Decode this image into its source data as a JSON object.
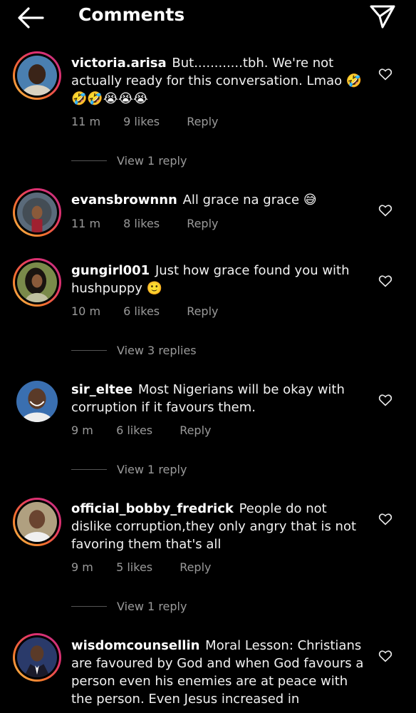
{
  "header": {
    "title": "Comments"
  },
  "comments": [
    {
      "username": "victoria.arisa",
      "text": "But............tbh. We're not actually ready for this conversation. Lmao 🤣🤣🤣😭😭😭",
      "time": "11 m",
      "likes": "9 likes",
      "reply_label": "Reply",
      "view_replies": "View 1 reply",
      "avatar_color": "#4a7fb0"
    },
    {
      "username": "evansbrownnn",
      "text": "All grace na grace 😅",
      "time": "11 m",
      "likes": "8 likes",
      "reply_label": "Reply",
      "avatar_color": "#5a6a7a"
    },
    {
      "username": "gungirl001",
      "text": "Just how grace found you with hushpuppy 🙂",
      "time": "10 m",
      "likes": "6 likes",
      "reply_label": "Reply",
      "view_replies": "View 3 replies",
      "avatar_color": "#7a8a4a"
    },
    {
      "username": "sir_eltee",
      "text": "Most Nigerians will be okay with corruption if it favours them.",
      "time": "9 m",
      "likes": "6 likes",
      "reply_label": "Reply",
      "view_replies": "View 1 reply",
      "avatar_color": "#3a6fb0"
    },
    {
      "username": "official_bobby_fredrick",
      "text": "People do not dislike corruption,they only angry that is not favoring them that's all",
      "time": "9 m",
      "likes": "5 likes",
      "reply_label": "Reply",
      "view_replies": "View 1 reply",
      "avatar_color": "#b0a080"
    },
    {
      "username": "wisdomcounsellin",
      "text": "Moral Lesson: Christians are favoured by God and when God favours a person even his enemies are at peace with the person. Even Jesus increased in",
      "avatar_color": "#2a3a6a"
    }
  ],
  "icons": {
    "back": "arrow-left-icon",
    "send": "paper-plane-icon",
    "like": "heart-outline-icon"
  },
  "colors": {
    "background": "#000000",
    "text": "#f1f1f1",
    "muted": "#9a9a9a",
    "story_ring": "#e1306c"
  }
}
